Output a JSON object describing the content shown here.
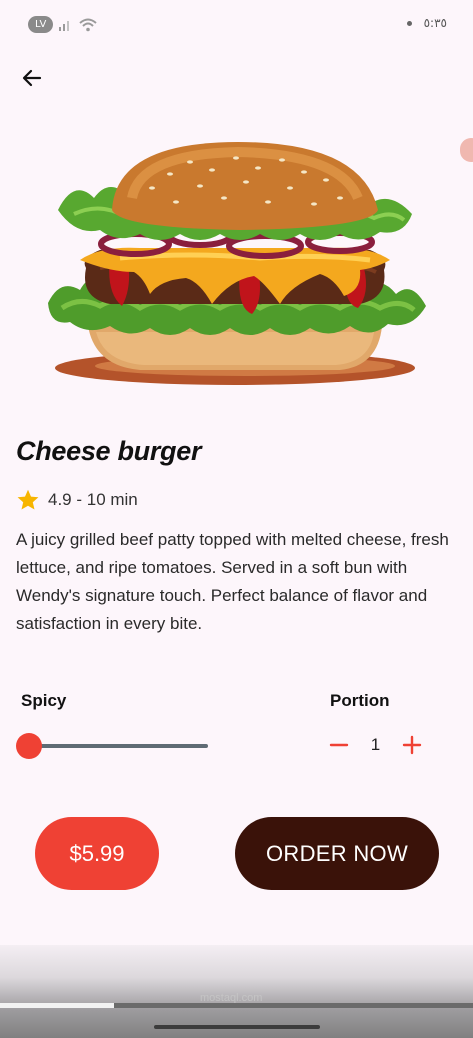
{
  "status_bar": {
    "left_badge": "LV",
    "time": "٥:٣٥"
  },
  "product": {
    "title": "Cheese burger",
    "rating_text": "4.9 - 10 min",
    "description": "A juicy grilled beef patty topped with melted cheese, fresh lettuce, and ripe tomatoes. Served in a soft bun with Wendy's signature touch. Perfect balance of flavor and satisfaction in every bite."
  },
  "options": {
    "spicy_label": "Spicy",
    "spicy_level": 0,
    "portion_label": "Portion",
    "portion_value": "1"
  },
  "actions": {
    "price": "$5.99",
    "order_label": "ORDER NOW"
  },
  "video_progress": 0.24,
  "watermark": "mostaql.com",
  "colors": {
    "accent": "#ef4134",
    "order_button": "#3a1209",
    "background": "#fdf6fb",
    "slider_track": "#5f6b74"
  },
  "icons": {
    "back": "arrow-left-icon",
    "rating": "star-icon",
    "decrease": "minus-icon",
    "increase": "plus-icon",
    "status_signal": "signal-icon",
    "status_wifi": "wifi-icon"
  }
}
